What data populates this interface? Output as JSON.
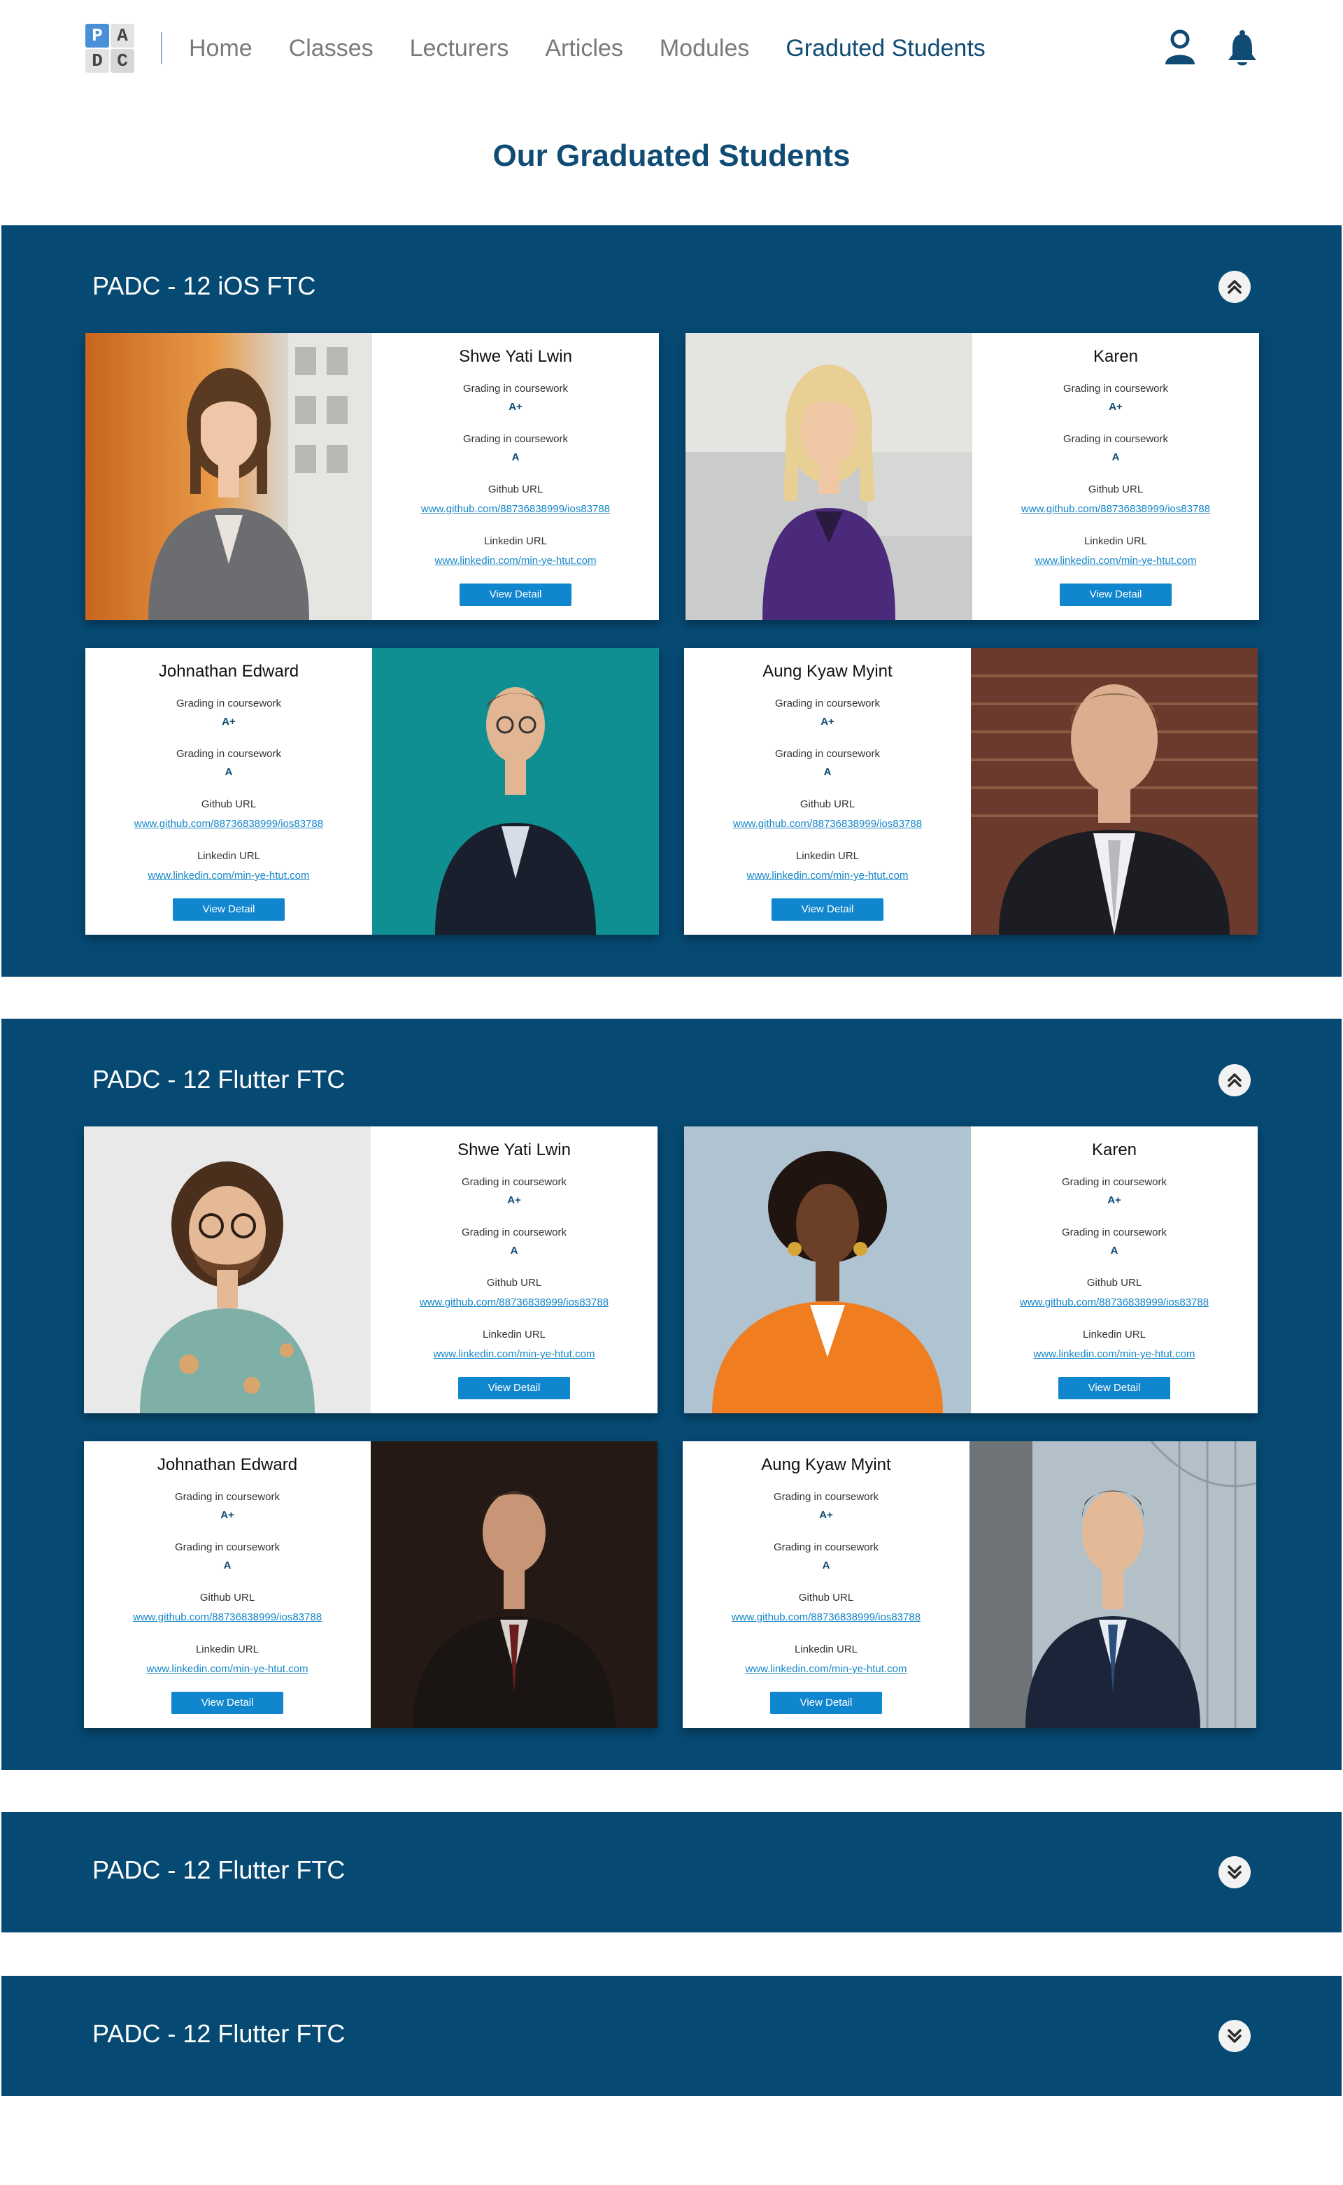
{
  "nav": {
    "logo": [
      "P",
      "A",
      "D",
      "C"
    ],
    "links": [
      {
        "label": "Home"
      },
      {
        "label": "Classes"
      },
      {
        "label": "Lecturers"
      },
      {
        "label": "Articles"
      },
      {
        "label": "Modules"
      },
      {
        "label": "Graduted Students",
        "active": true
      }
    ]
  },
  "page_title": "Our Graduated Students",
  "colors": {
    "primary": "#064a73",
    "accent": "#0f86cd",
    "link": "#1686c8",
    "title": "#0f4b73"
  },
  "sections": [
    {
      "title": "PADC - 12 iOS FTC",
      "expanded": true,
      "toggle_icon": "chevron-double-up-icon",
      "students": [
        {
          "name": "Shwe Yati Lwin",
          "grade_label_1": "Grading in coursework",
          "grade_1": "A+",
          "grade_label_2": "Grading in coursework",
          "grade_2": "A",
          "github_label": "Github URL",
          "github_url": "www.github.com/88736838999/ios83788",
          "linkedin_label": "Linkedin URL",
          "linkedin_url": "www.linkedin.com/min-ye-htut.com",
          "button": "View Detail"
        },
        {
          "name": "Karen",
          "grade_label_1": "Grading in coursework",
          "grade_1": "A+",
          "grade_label_2": "Grading in coursework",
          "grade_2": "A",
          "github_label": "Github URL",
          "github_url": "www.github.com/88736838999/ios83788",
          "linkedin_label": "Linkedin URL",
          "linkedin_url": "www.linkedin.com/min-ye-htut.com",
          "button": "View Detail"
        },
        {
          "name": "Johnathan Edward",
          "grade_label_1": "Grading in coursework",
          "grade_1": "A+",
          "grade_label_2": "Grading in coursework",
          "grade_2": "A",
          "github_label": "Github URL",
          "github_url": "www.github.com/88736838999/ios83788",
          "linkedin_label": "Linkedin URL",
          "linkedin_url": "www.linkedin.com/min-ye-htut.com",
          "button": "View Detail"
        },
        {
          "name": "Aung Kyaw Myint",
          "grade_label_1": "Grading in coursework",
          "grade_1": "A+",
          "grade_label_2": "Grading in coursework",
          "grade_2": "A",
          "github_label": "Github URL",
          "github_url": "www.github.com/88736838999/ios83788",
          "linkedin_label": "Linkedin URL",
          "linkedin_url": "www.linkedin.com/min-ye-htut.com",
          "button": "View Detail"
        }
      ]
    },
    {
      "title": "PADC - 12 Flutter FTC",
      "expanded": true,
      "toggle_icon": "chevron-double-up-icon",
      "students": [
        {
          "name": "Shwe Yati Lwin",
          "grade_label_1": "Grading in coursework",
          "grade_1": "A+",
          "grade_label_2": "Grading in coursework",
          "grade_2": "A",
          "github_label": "Github URL",
          "github_url": "www.github.com/88736838999/ios83788",
          "linkedin_label": "Linkedin URL",
          "linkedin_url": "www.linkedin.com/min-ye-htut.com",
          "button": "View Detail"
        },
        {
          "name": "Karen",
          "grade_label_1": "Grading in coursework",
          "grade_1": "A+",
          "grade_label_2": "Grading in coursework",
          "grade_2": "A",
          "github_label": "Github URL",
          "github_url": "www.github.com/88736838999/ios83788",
          "linkedin_label": "Linkedin URL",
          "linkedin_url": "www.linkedin.com/min-ye-htut.com",
          "button": "View Detail"
        },
        {
          "name": "Johnathan Edward",
          "grade_label_1": "Grading in coursework",
          "grade_1": "A+",
          "grade_label_2": "Grading in coursework",
          "grade_2": "A",
          "github_label": "Github URL",
          "github_url": "www.github.com/88736838999/ios83788",
          "linkedin_label": "Linkedin URL",
          "linkedin_url": "www.linkedin.com/min-ye-htut.com",
          "button": "View Detail"
        },
        {
          "name": "Aung Kyaw Myint",
          "grade_label_1": "Grading in coursework",
          "grade_1": "A+",
          "grade_label_2": "Grading in coursework",
          "grade_2": "A",
          "github_label": "Github URL",
          "github_url": "www.github.com/88736838999/ios83788",
          "linkedin_label": "Linkedin URL",
          "linkedin_url": "www.linkedin.com/min-ye-htut.com",
          "button": "View Detail"
        }
      ]
    },
    {
      "title": "PADC - 12 Flutter FTC",
      "expanded": false,
      "toggle_icon": "chevron-double-down-icon"
    },
    {
      "title": "PADC - 12 Flutter FTC",
      "expanded": false,
      "toggle_icon": "chevron-double-down-icon"
    }
  ]
}
